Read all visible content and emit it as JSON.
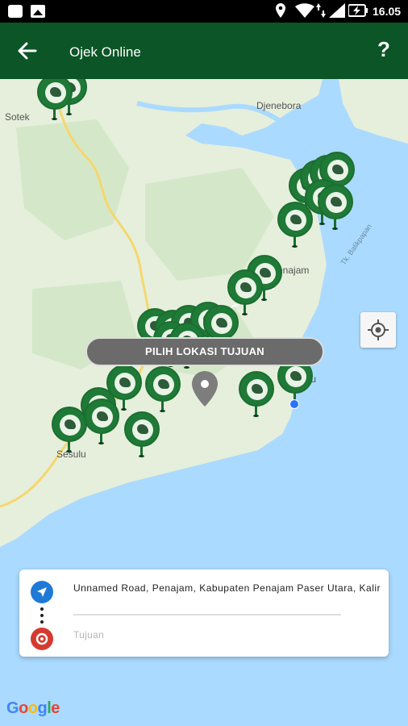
{
  "status_bar": {
    "time": "16.05"
  },
  "app_bar": {
    "title": "Ojek Online",
    "help_label": "?"
  },
  "map": {
    "place_labels": [
      {
        "name": "Sotek"
      },
      {
        "name": "Djenebora"
      },
      {
        "name": "Penajam"
      },
      {
        "name": "Tk. Balikpapan"
      },
      {
        "name": "Sesulu"
      },
      {
        "name": "npu"
      }
    ],
    "pick_destination_label": "PILIH LOKASI TUJUAN",
    "driver_marker_count": 26
  },
  "route_card": {
    "origin": "Unnamed Road, Penajam, Kabupaten Penajam Paser Utara, Kalir",
    "destination_placeholder": "Tujuan"
  },
  "attribution": {
    "letters": [
      "G",
      "o",
      "o",
      "g",
      "l",
      "e"
    ]
  },
  "colors": {
    "app_bar": "#0b5526",
    "marker": "#1e7a36",
    "water": "#aadaff",
    "land": "#e6efdc",
    "origin_icon": "#1f79d6",
    "destination_icon": "#d43a2f"
  }
}
